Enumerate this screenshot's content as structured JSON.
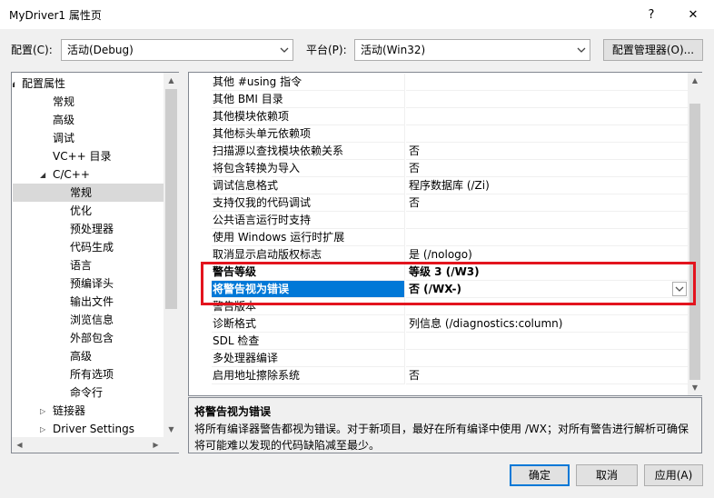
{
  "window": {
    "title": "MyDriver1 属性页",
    "help": "?",
    "close": "✕"
  },
  "toolbar": {
    "config_label": "配置(C):",
    "config_value": "活动(Debug)",
    "platform_label": "平台(P):",
    "platform_value": "活动(Win32)",
    "manager_button": "配置管理器(O)..."
  },
  "tree": {
    "items": [
      {
        "label": "配置属性",
        "level": 0,
        "expanded": true
      },
      {
        "label": "常规",
        "level": 1
      },
      {
        "label": "高级",
        "level": 1
      },
      {
        "label": "调试",
        "level": 1
      },
      {
        "label": "VC++ 目录",
        "level": 1
      },
      {
        "label": "C/C++",
        "level": 1,
        "expanded": true
      },
      {
        "label": "常规",
        "level": 2,
        "selected": true
      },
      {
        "label": "优化",
        "level": 2
      },
      {
        "label": "预处理器",
        "level": 2
      },
      {
        "label": "代码生成",
        "level": 2
      },
      {
        "label": "语言",
        "level": 2
      },
      {
        "label": "预编译头",
        "level": 2
      },
      {
        "label": "输出文件",
        "level": 2
      },
      {
        "label": "浏览信息",
        "level": 2
      },
      {
        "label": "外部包含",
        "level": 2
      },
      {
        "label": "高级",
        "level": 2
      },
      {
        "label": "所有选项",
        "level": 2
      },
      {
        "label": "命令行",
        "level": 2
      },
      {
        "label": "链接器",
        "level": 1,
        "collapsed": true
      },
      {
        "label": "Driver Settings",
        "level": 1,
        "collapsed": true
      }
    ]
  },
  "properties": [
    {
      "name": "其他 #using 指令",
      "value": ""
    },
    {
      "name": "其他 BMI 目录",
      "value": ""
    },
    {
      "name": "其他模块依赖项",
      "value": ""
    },
    {
      "name": "其他标头单元依赖项",
      "value": ""
    },
    {
      "name": "扫描源以查找模块依赖关系",
      "value": "否"
    },
    {
      "name": "将包含转换为导入",
      "value": "否"
    },
    {
      "name": "调试信息格式",
      "value": "程序数据库 (/Zi)"
    },
    {
      "name": "支持仅我的代码调试",
      "value": "否"
    },
    {
      "name": "公共语言运行时支持",
      "value": ""
    },
    {
      "name": "使用 Windows 运行时扩展",
      "value": ""
    },
    {
      "name": "取消显示启动版权标志",
      "value": "是 (/nologo)"
    },
    {
      "name": "警告等级",
      "value": "等级 3 (/W3)",
      "bold": true
    },
    {
      "name": "将警告视为错误",
      "value": "否 (/WX-)",
      "bold": true,
      "selected": true
    },
    {
      "name": "警告版本",
      "value": ""
    },
    {
      "name": "诊断格式",
      "value": "列信息 (/diagnostics:column)"
    },
    {
      "name": "SDL 检查",
      "value": ""
    },
    {
      "name": "多处理器编译",
      "value": ""
    },
    {
      "name": "启用地址擦除系统",
      "value": "否"
    }
  ],
  "description": {
    "title": "将警告视为错误",
    "line1": "将所有编译器警告都视为错误。对于新项目，最好在所有编译中使用 /WX；对所有警告进行解析可确保",
    "line2": "将可能难以发现的代码缺陷减至最少。"
  },
  "buttons": {
    "ok": "确定",
    "cancel": "取消",
    "apply": "应用(A)"
  },
  "colors": {
    "highlight": "#e3141e",
    "selection": "#0078d7"
  }
}
